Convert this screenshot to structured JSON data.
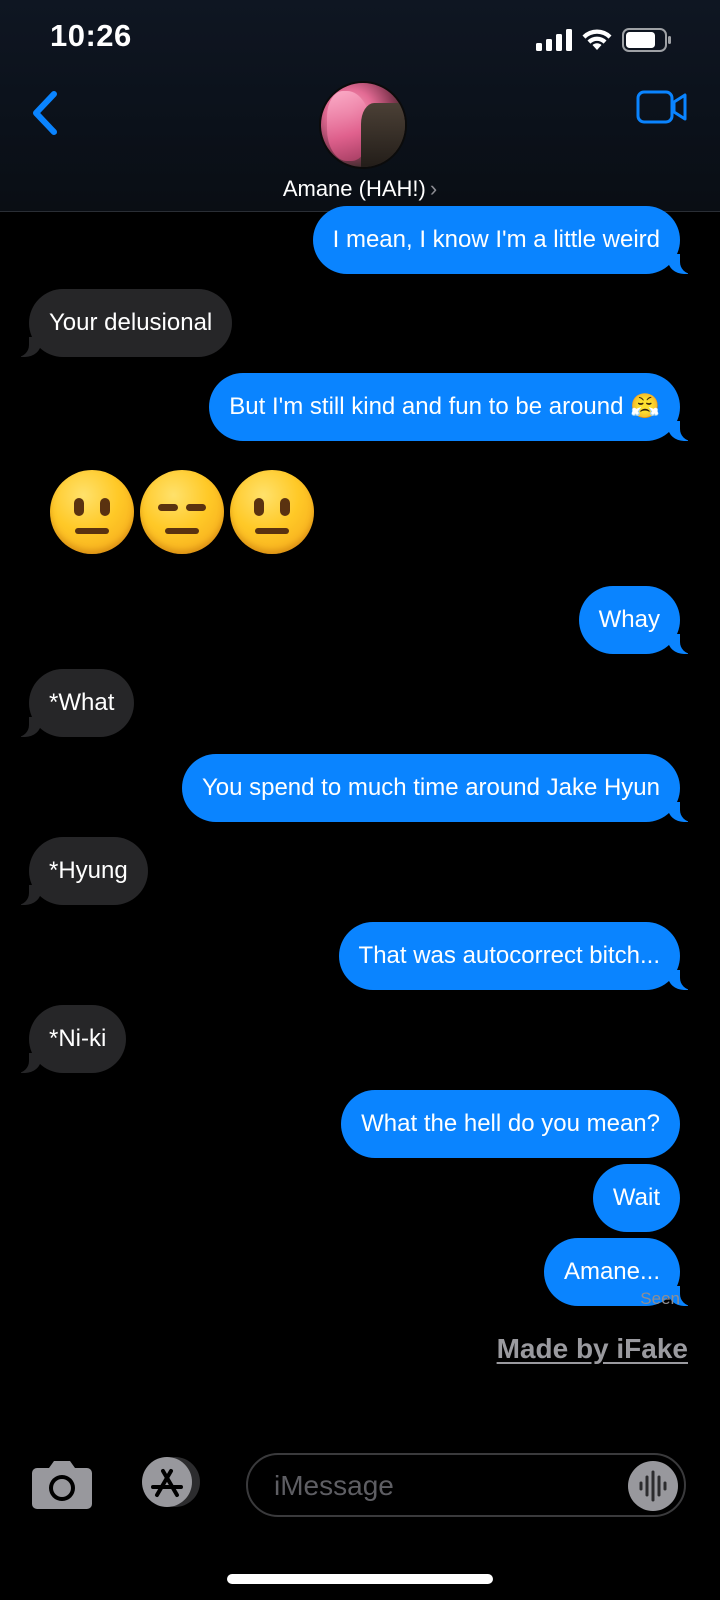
{
  "status_bar": {
    "time": "10:26"
  },
  "header": {
    "contact_name": "Amane (HAH!)",
    "chevron": "›"
  },
  "messages": [
    {
      "from": "me",
      "text": "I mean, I know I'm a little weird"
    },
    {
      "from": "them",
      "text": "Your delusional"
    },
    {
      "from": "me",
      "text": "But I'm still kind and fun to be around 😤"
    },
    {
      "from": "them",
      "text": "😐😑😐"
    },
    {
      "from": "me",
      "text": "Whay"
    },
    {
      "from": "them",
      "text": "*What"
    },
    {
      "from": "me",
      "text": "You spend to much time around Jake Hyun"
    },
    {
      "from": "them",
      "text": "*Hyung"
    },
    {
      "from": "me",
      "text": "That was autocorrect bitch..."
    },
    {
      "from": "them",
      "text": "*Ni-ki"
    },
    {
      "from": "me",
      "text": "What the hell do you mean?"
    },
    {
      "from": "me",
      "text": "Wait"
    },
    {
      "from": "me",
      "text": "Amane..."
    }
  ],
  "receipt": "Seen",
  "watermark": "Made by iFake",
  "composer": {
    "placeholder": "iMessage"
  },
  "icons": [
    "back-chevron-icon",
    "video-camera-icon",
    "camera-icon",
    "app-store-icon",
    "audio-waveform-icon"
  ],
  "colors": {
    "outgoing_bubble": "#0a84ff",
    "incoming_bubble": "#262628",
    "accent": "#0a84ff"
  }
}
